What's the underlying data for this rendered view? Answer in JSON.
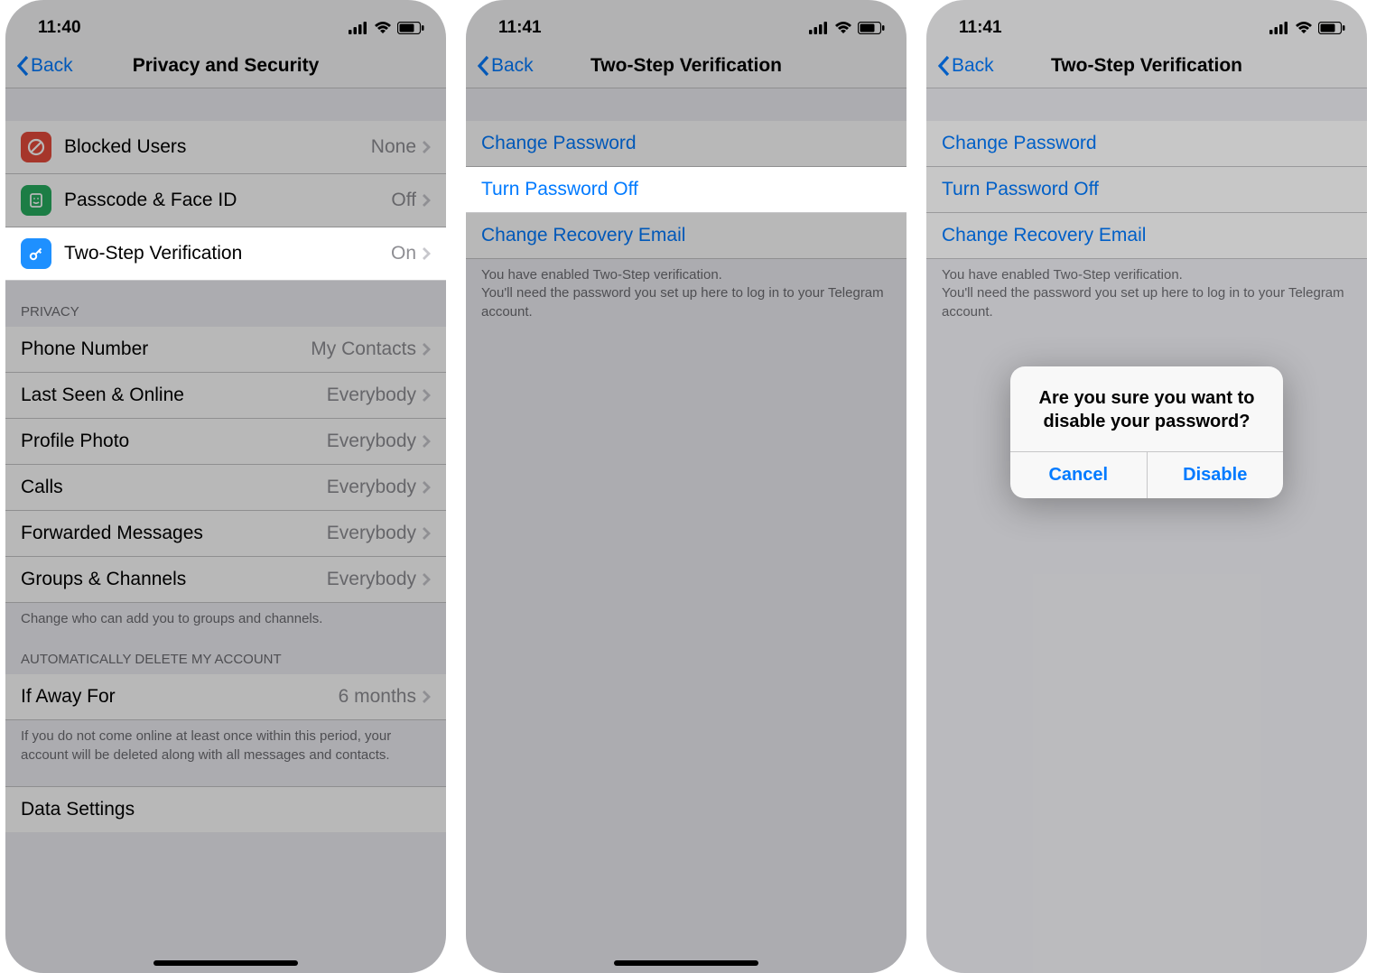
{
  "phone1": {
    "time": "11:40",
    "nav_back": "Back",
    "nav_title": "Privacy and Security",
    "securityRows": [
      {
        "label": "Blocked Users",
        "value": "None"
      },
      {
        "label": "Passcode & Face ID",
        "value": "Off"
      },
      {
        "label": "Two-Step Verification",
        "value": "On"
      }
    ],
    "privacyHeader": "PRIVACY",
    "privacyRows": [
      {
        "label": "Phone Number",
        "value": "My Contacts"
      },
      {
        "label": "Last Seen & Online",
        "value": "Everybody"
      },
      {
        "label": "Profile Photo",
        "value": "Everybody"
      },
      {
        "label": "Calls",
        "value": "Everybody"
      },
      {
        "label": "Forwarded Messages",
        "value": "Everybody"
      },
      {
        "label": "Groups & Channels",
        "value": "Everybody"
      }
    ],
    "privacyFooter": "Change who can add you to groups and channels.",
    "autoDeleteHeader": "AUTOMATICALLY DELETE MY ACCOUNT",
    "autoDeleteRow": {
      "label": "If Away For",
      "value": "6 months"
    },
    "autoDeleteFooter": "If you do not come online at least once within this period, your account will be deleted along with all messages and contacts.",
    "dataSettings": "Data Settings"
  },
  "phone2": {
    "time": "11:41",
    "nav_back": "Back",
    "nav_title": "Two-Step Verification",
    "rows": [
      "Change Password",
      "Turn Password Off",
      "Change Recovery Email"
    ],
    "footer": "You have enabled Two-Step verification.\nYou'll need the password you set up here to log in to your Telegram account."
  },
  "phone3": {
    "time": "11:41",
    "nav_back": "Back",
    "nav_title": "Two-Step Verification",
    "rows": [
      "Change Password",
      "Turn Password Off",
      "Change Recovery Email"
    ],
    "footer": "You have enabled Two-Step verification.\nYou'll need the password you set up here to log in to your Telegram account.",
    "alert": {
      "title": "Are you sure you want to disable your password?",
      "cancel": "Cancel",
      "disable": "Disable"
    }
  }
}
